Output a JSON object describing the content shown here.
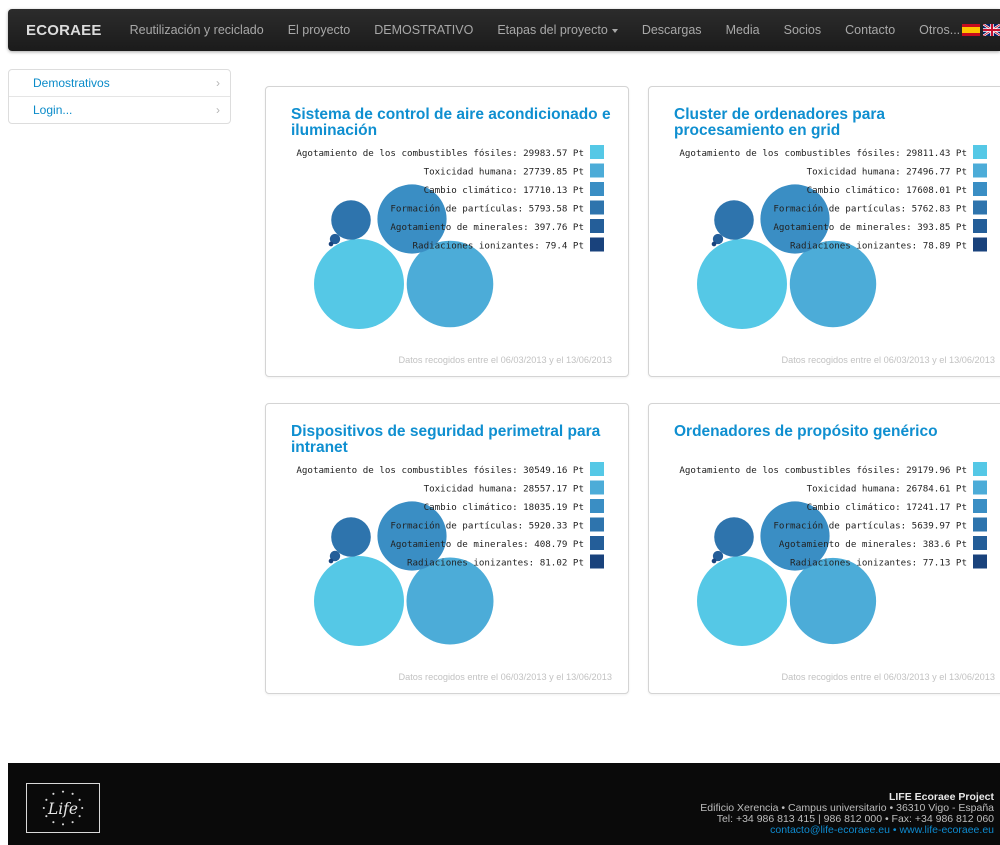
{
  "navbar": {
    "brand": "ECORAEE",
    "items": [
      {
        "label": "Reutilización y reciclado"
      },
      {
        "label": "El proyecto"
      },
      {
        "label": "DEMOSTRATIVO"
      },
      {
        "label": "Etapas del proyecto"
      },
      {
        "label": "Descargas"
      },
      {
        "label": "Media"
      },
      {
        "label": "Socios"
      },
      {
        "label": "Contacto"
      },
      {
        "label": "Otros..."
      }
    ]
  },
  "sidebar": {
    "items": [
      {
        "label": "Demostrativos"
      },
      {
        "label": "Login..."
      }
    ]
  },
  "legend_colors": [
    "#55c8e6",
    "#4cacd8",
    "#3a8ec4",
    "#2e74ad",
    "#245e99",
    "#19427c"
  ],
  "cards": [
    {
      "title": "Sistema de control de aire acondicionado e iluminación",
      "footnote": "Datos recogidos entre el 06/03/2013 y el 13/06/2013",
      "chart_data": {
        "type": "bubble",
        "series": [
          {
            "name": "Agotamiento de los combustibles fósiles",
            "value": 29983.57,
            "label": "Agotamiento de los combustibles fósiles: 29983.57 Pt"
          },
          {
            "name": "Toxicidad humana",
            "value": 27739.85,
            "label": "Toxicidad humana: 27739.85 Pt"
          },
          {
            "name": "Cambio climático",
            "value": 17710.13,
            "label": "Cambio climático: 17710.13 Pt"
          },
          {
            "name": "Formación de partículas",
            "value": 5793.58,
            "label": "Formación de partículas: 5793.58 Pt"
          },
          {
            "name": "Agotamiento de minerales",
            "value": 397.76,
            "label": "Agotamiento de minerales: 397.76 Pt"
          },
          {
            "name": "Radiaciones ionizantes",
            "value": 79.4,
            "label": "Radiaciones ionizantes: 79.4 Pt"
          }
        ]
      }
    },
    {
      "title": "Cluster de ordenadores para procesamiento en grid",
      "footnote": "Datos recogidos entre el 06/03/2013 y el 13/06/2013",
      "chart_data": {
        "type": "bubble",
        "series": [
          {
            "name": "Agotamiento de los combustibles fósiles",
            "value": 29811.43,
            "label": "Agotamiento de los combustibles fósiles: 29811.43 Pt"
          },
          {
            "name": "Toxicidad humana",
            "value": 27496.77,
            "label": "Toxicidad humana: 27496.77 Pt"
          },
          {
            "name": "Cambio climático",
            "value": 17608.01,
            "label": "Cambio climático: 17608.01 Pt"
          },
          {
            "name": "Formación de partículas",
            "value": 5762.83,
            "label": "Formación de partículas: 5762.83 Pt"
          },
          {
            "name": "Agotamiento de minerales",
            "value": 393.85,
            "label": "Agotamiento de minerales: 393.85 Pt"
          },
          {
            "name": "Radiaciones ionizantes",
            "value": 78.89,
            "label": "Radiaciones ionizantes: 78.89 Pt"
          }
        ]
      }
    },
    {
      "title": "Dispositivos de seguridad perimetral para intranet",
      "footnote": "Datos recogidos entre el 06/03/2013 y el 13/06/2013",
      "chart_data": {
        "type": "bubble",
        "series": [
          {
            "name": "Agotamiento de los combustibles fósiles",
            "value": 30549.16,
            "label": "Agotamiento de los combustibles fósiles: 30549.16 Pt"
          },
          {
            "name": "Toxicidad humana",
            "value": 28557.17,
            "label": "Toxicidad humana: 28557.17 Pt"
          },
          {
            "name": "Cambio climático",
            "value": 18035.19,
            "label": "Cambio climático: 18035.19 Pt"
          },
          {
            "name": "Formación de partículas",
            "value": 5920.33,
            "label": "Formación de partículas: 5920.33 Pt"
          },
          {
            "name": "Agotamiento de minerales",
            "value": 408.79,
            "label": "Agotamiento de minerales: 408.79 Pt"
          },
          {
            "name": "Radiaciones ionizantes",
            "value": 81.02,
            "label": "Radiaciones ionizantes: 81.02 Pt"
          }
        ]
      }
    },
    {
      "title": "Ordenadores de propósito genérico",
      "footnote": "Datos recogidos entre el 06/03/2013 y el 13/06/2013",
      "chart_data": {
        "type": "bubble",
        "series": [
          {
            "name": "Agotamiento de los combustibles fósiles",
            "value": 29179.96,
            "label": "Agotamiento de los combustibles fósiles: 29179.96 Pt"
          },
          {
            "name": "Toxicidad humana",
            "value": 26784.61,
            "label": "Toxicidad humana: 26784.61 Pt"
          },
          {
            "name": "Cambio climático",
            "value": 17241.17,
            "label": "Cambio climático: 17241.17 Pt"
          },
          {
            "name": "Formación de partículas",
            "value": 5639.97,
            "label": "Formación de partículas: 5639.97 Pt"
          },
          {
            "name": "Agotamiento de minerales",
            "value": 383.6,
            "label": "Agotamiento de minerales: 383.6 Pt"
          },
          {
            "name": "Radiaciones ionizantes",
            "value": 77.13,
            "label": "Radiaciones ionizantes: 77.13 Pt"
          }
        ]
      }
    }
  ],
  "footer": {
    "logo_text": "Life",
    "project": "LIFE Ecoraee Project",
    "address": "Edificio Xerencia • Campus universitario • 36310 Vigo - España",
    "phones": "Tel: +34 986 813 415 | 986 812 000 • Fax: +34 986 812 060",
    "links": "contacto@life-ecoraee.eu • www.life-ecoraee.eu"
  },
  "icons": {
    "chevron": "chevron-right-icon",
    "flag_es": "spain-flag-icon",
    "flag_uk": "uk-flag-icon",
    "caret": "caret-down-icon"
  }
}
